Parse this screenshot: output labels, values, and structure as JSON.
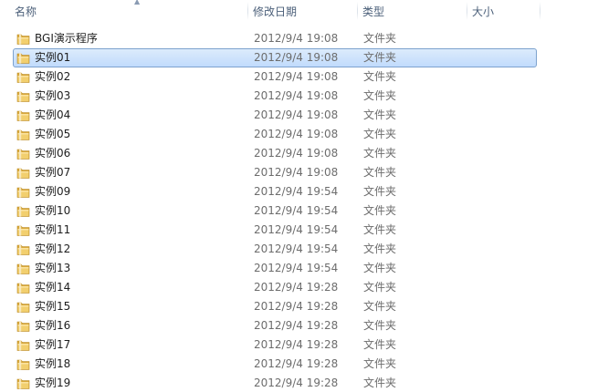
{
  "columns": {
    "name": "名称",
    "date": "修改日期",
    "type": "类型",
    "size": "大小",
    "sort_indicator": "ascending"
  },
  "colors": {
    "header_text": "#4c607a",
    "secondary_text": "#6d6d6d",
    "selection_border": "#7da2ce",
    "selection_fill": "#c9e0fb",
    "folder": "#e8c15b"
  },
  "items": [
    {
      "name": "BGI演示程序",
      "date": "2012/9/4 19:08",
      "type": "文件夹",
      "size": "",
      "icon": "folder-icon",
      "selected": false
    },
    {
      "name": "实例01",
      "date": "2012/9/4 19:08",
      "type": "文件夹",
      "size": "",
      "icon": "folder-icon",
      "selected": true
    },
    {
      "name": "实例02",
      "date": "2012/9/4 19:08",
      "type": "文件夹",
      "size": "",
      "icon": "folder-icon",
      "selected": false
    },
    {
      "name": "实例03",
      "date": "2012/9/4 19:08",
      "type": "文件夹",
      "size": "",
      "icon": "folder-icon",
      "selected": false
    },
    {
      "name": "实例04",
      "date": "2012/9/4 19:08",
      "type": "文件夹",
      "size": "",
      "icon": "folder-icon",
      "selected": false
    },
    {
      "name": "实例05",
      "date": "2012/9/4 19:08",
      "type": "文件夹",
      "size": "",
      "icon": "folder-icon",
      "selected": false
    },
    {
      "name": "实例06",
      "date": "2012/9/4 19:08",
      "type": "文件夹",
      "size": "",
      "icon": "folder-icon",
      "selected": false
    },
    {
      "name": "实例07",
      "date": "2012/9/4 19:08",
      "type": "文件夹",
      "size": "",
      "icon": "folder-icon",
      "selected": false
    },
    {
      "name": "实例09",
      "date": "2012/9/4 19:54",
      "type": "文件夹",
      "size": "",
      "icon": "folder-icon",
      "selected": false
    },
    {
      "name": "实例10",
      "date": "2012/9/4 19:54",
      "type": "文件夹",
      "size": "",
      "icon": "folder-icon",
      "selected": false
    },
    {
      "name": "实例11",
      "date": "2012/9/4 19:54",
      "type": "文件夹",
      "size": "",
      "icon": "folder-icon",
      "selected": false
    },
    {
      "name": "实例12",
      "date": "2012/9/4 19:54",
      "type": "文件夹",
      "size": "",
      "icon": "folder-icon",
      "selected": false
    },
    {
      "name": "实例13",
      "date": "2012/9/4 19:54",
      "type": "文件夹",
      "size": "",
      "icon": "folder-icon",
      "selected": false
    },
    {
      "name": "实例14",
      "date": "2012/9/4 19:28",
      "type": "文件夹",
      "size": "",
      "icon": "folder-icon",
      "selected": false
    },
    {
      "name": "实例15",
      "date": "2012/9/4 19:28",
      "type": "文件夹",
      "size": "",
      "icon": "folder-icon",
      "selected": false
    },
    {
      "name": "实例16",
      "date": "2012/9/4 19:28",
      "type": "文件夹",
      "size": "",
      "icon": "folder-icon",
      "selected": false
    },
    {
      "name": "实例17",
      "date": "2012/9/4 19:28",
      "type": "文件夹",
      "size": "",
      "icon": "folder-icon",
      "selected": false
    },
    {
      "name": "实例18",
      "date": "2012/9/4 19:28",
      "type": "文件夹",
      "size": "",
      "icon": "folder-icon",
      "selected": false
    },
    {
      "name": "实例19",
      "date": "2012/9/4 19:28",
      "type": "文件夹",
      "size": "",
      "icon": "folder-icon",
      "selected": false
    }
  ]
}
